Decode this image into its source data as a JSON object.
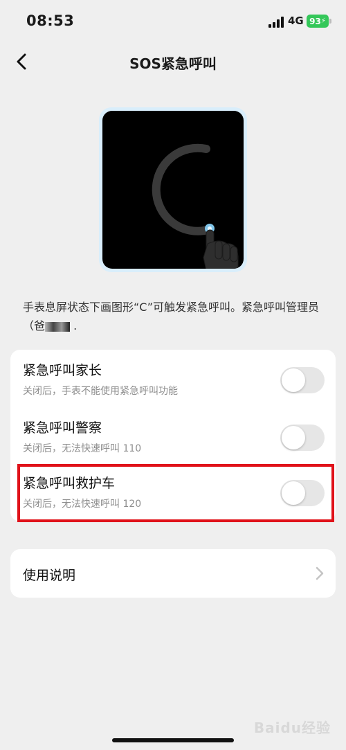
{
  "status_bar": {
    "time": "08:53",
    "network": "4G",
    "battery": "93"
  },
  "nav": {
    "title": "SOS紧急呼叫"
  },
  "illustration": {
    "gesture_letter": "C",
    "icon": "hand-pointer-icon"
  },
  "description": {
    "text_before": "手表息屏状态下画图形“C”可触发紧急呼叫。紧急呼叫管理员（爸",
    "text_after": " ."
  },
  "settings": [
    {
      "title": "紧急呼叫家长",
      "subtitle": "关闭后，手表不能使用紧急呼叫功能",
      "enabled": false
    },
    {
      "title": "紧急呼叫警察",
      "subtitle": "关闭后，无法快速呼叫 110",
      "enabled": false
    },
    {
      "title": "紧急呼叫救护车",
      "subtitle": "关闭后，无法快速呼叫 120",
      "enabled": false
    }
  ],
  "help": {
    "label": "使用说明"
  },
  "watermark": "Baidu经验",
  "colors": {
    "background": "#efefef",
    "highlight": "#e0121a",
    "battery": "#34c759",
    "toggle_off": "#e6e6e6"
  }
}
